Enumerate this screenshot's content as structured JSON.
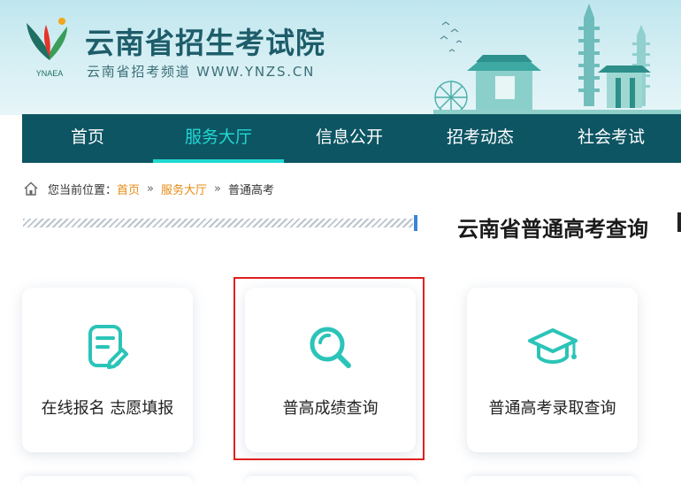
{
  "header": {
    "logo_text": "YNAEA",
    "title": "云南省招生考试院",
    "subtitle": "云南省招考频道 WWW.YNZS.CN"
  },
  "nav": {
    "items": [
      {
        "label": "首页"
      },
      {
        "label": "服务大厅"
      },
      {
        "label": "信息公开"
      },
      {
        "label": "招考动态"
      },
      {
        "label": "社会考试"
      }
    ]
  },
  "breadcrumb": {
    "prefix": "您当前位置：",
    "items": [
      "首页",
      "服务大厅",
      "普通高考"
    ],
    "separator": "»"
  },
  "section": {
    "title": "云南省普通高考查询"
  },
  "cards": [
    {
      "label": "在线报名 志愿填报",
      "icon": "form-edit-icon"
    },
    {
      "label": "普高成绩查询",
      "icon": "search-icon"
    },
    {
      "label": "普通高考录取查询",
      "icon": "graduation-cap-icon"
    }
  ],
  "colors": {
    "nav_bg": "#0d5563",
    "nav_active": "#21d8d2",
    "icon_teal": "#2bc4b8",
    "breadcrumb_link": "#e58a16",
    "highlight_border": "#e02020"
  }
}
